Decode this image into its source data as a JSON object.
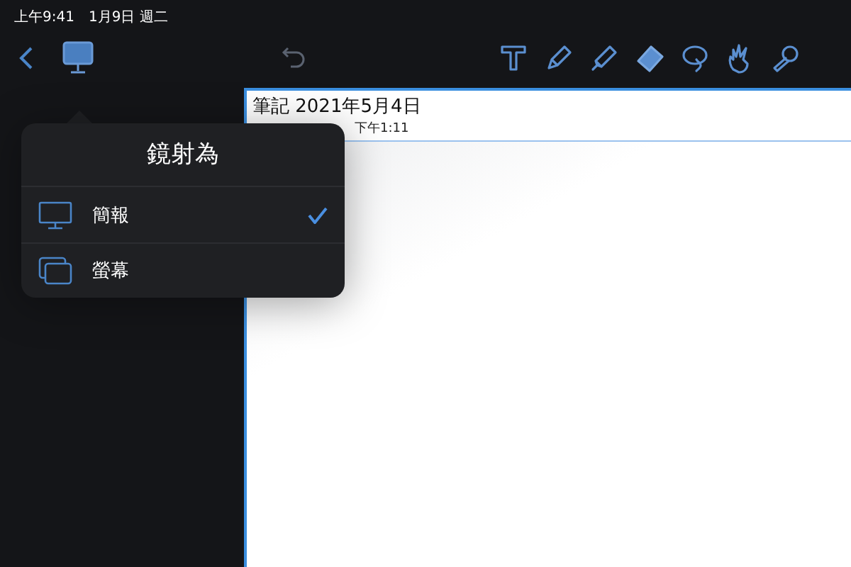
{
  "status_bar": {
    "time": "上午9:41",
    "date": "1月9日 週二"
  },
  "toolbar": {
    "mirror_selected": true,
    "tools": [
      {
        "kind": "text",
        "selected": false
      },
      {
        "kind": "pen",
        "selected": false
      },
      {
        "kind": "highlighter",
        "selected": false
      },
      {
        "kind": "eraser",
        "selected": true
      },
      {
        "kind": "lasso",
        "selected": false
      },
      {
        "kind": "hand",
        "selected": false
      },
      {
        "kind": "laser",
        "selected": false
      }
    ]
  },
  "note": {
    "title": "筆記 2021年5月4日",
    "subtitle": "下午1:11"
  },
  "popover": {
    "title": "鏡射為",
    "options": [
      {
        "kind": "presentation",
        "label": "簡報",
        "selected": true
      },
      {
        "kind": "screen",
        "label": "螢幕",
        "selected": false
      }
    ]
  }
}
